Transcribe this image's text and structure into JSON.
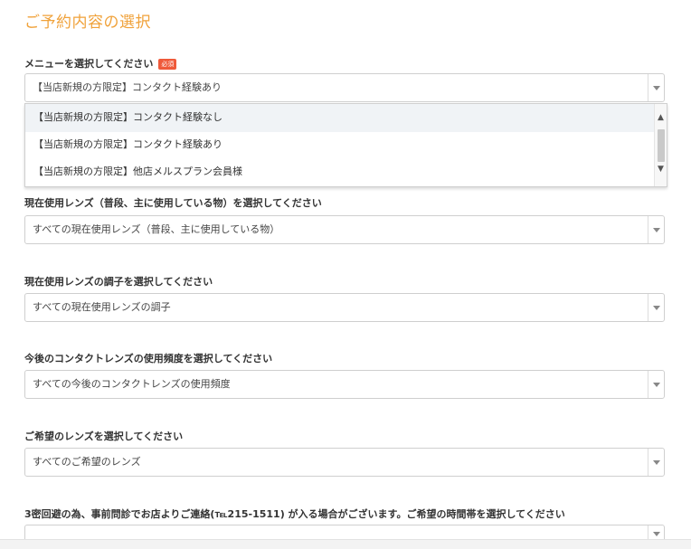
{
  "section_title": "ご予約内容の選択",
  "required_badge": "必須",
  "menu": {
    "label": "メニューを選択してください",
    "selected": "【当店新規の方限定】コンタクト経験あり",
    "options": [
      "【当店新規の方限定】コンタクト経験なし",
      "【当店新規の方限定】コンタクト経験あり",
      "【当店新規の方限定】他店メルスプラン会員様"
    ]
  },
  "current_lens": {
    "label": "現在使用レンズ（普段、主に使用している物）を選択してください",
    "selected": "すべての現在使用レンズ（普段、主に使用している物）"
  },
  "lens_condition": {
    "label": "現在使用レンズの調子を選択してください",
    "selected": "すべての現在使用レンズの調子"
  },
  "usage_frequency": {
    "label": "今後のコンタクトレンズの使用頻度を選択してください",
    "selected": "すべての今後のコンタクトレンズの使用頻度"
  },
  "desired_lens": {
    "label": "ご希望のレンズを選択してください",
    "selected": "すべてのご希望のレンズ"
  },
  "contact_time": {
    "label": "3密回避の為、事前問診でお店よりご連絡(℡215-1511) が入る場合がございます。ご希望の時間帯を選択してください"
  },
  "colors": {
    "title": "#f0a23b",
    "required_badge": "#ef5a3a"
  }
}
